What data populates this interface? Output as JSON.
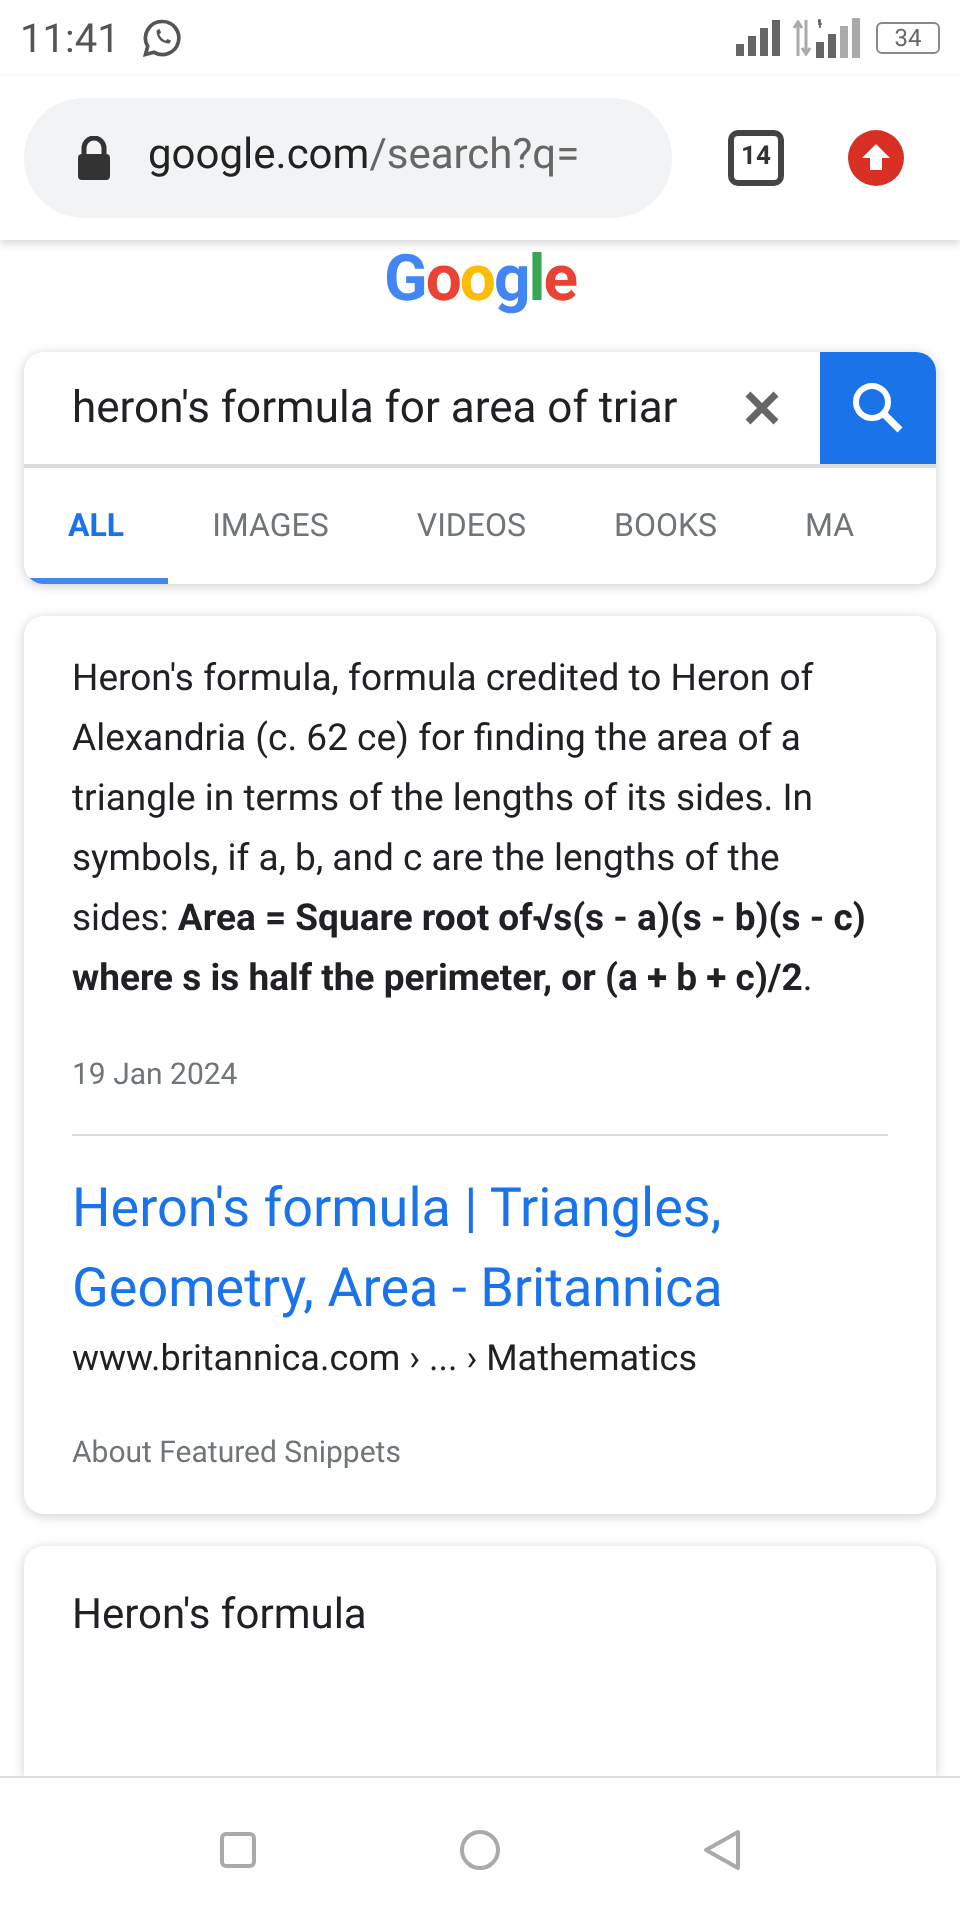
{
  "status_bar": {
    "time": "11:41",
    "battery": "34"
  },
  "address_bar": {
    "url_host": "google.com",
    "url_path": "/search?q=",
    "tab_count": "14"
  },
  "logo": "Google",
  "search": {
    "value": "heron's formula for area of triar"
  },
  "tabs": [
    {
      "label": "ALL",
      "selected": true
    },
    {
      "label": "IMAGES",
      "selected": false
    },
    {
      "label": "VIDEOS",
      "selected": false
    },
    {
      "label": "BOOKS",
      "selected": false
    },
    {
      "label": "MA",
      "selected": false
    }
  ],
  "snippet": {
    "text": "Heron's formula, formula credited to Heron of Alexandria (c. 62 ce) for finding the area of a triangle in terms of the lengths of its sides. In symbols, if a, b, and c are the lengths of the sides: **Area = Square root of√s(s - a)(s - b)(s - c) where s is half the perimeter, or (a + b + c)/2**.",
    "date": "19 Jan 2024",
    "link_title": "Heron's formula | Triangles, Geometry, Area - Britannica",
    "breadcrumb": "www.britannica.com › ... › Mathematics",
    "footer": "About Featured Snippets"
  },
  "next_card": {
    "title": "Heron's formula"
  }
}
